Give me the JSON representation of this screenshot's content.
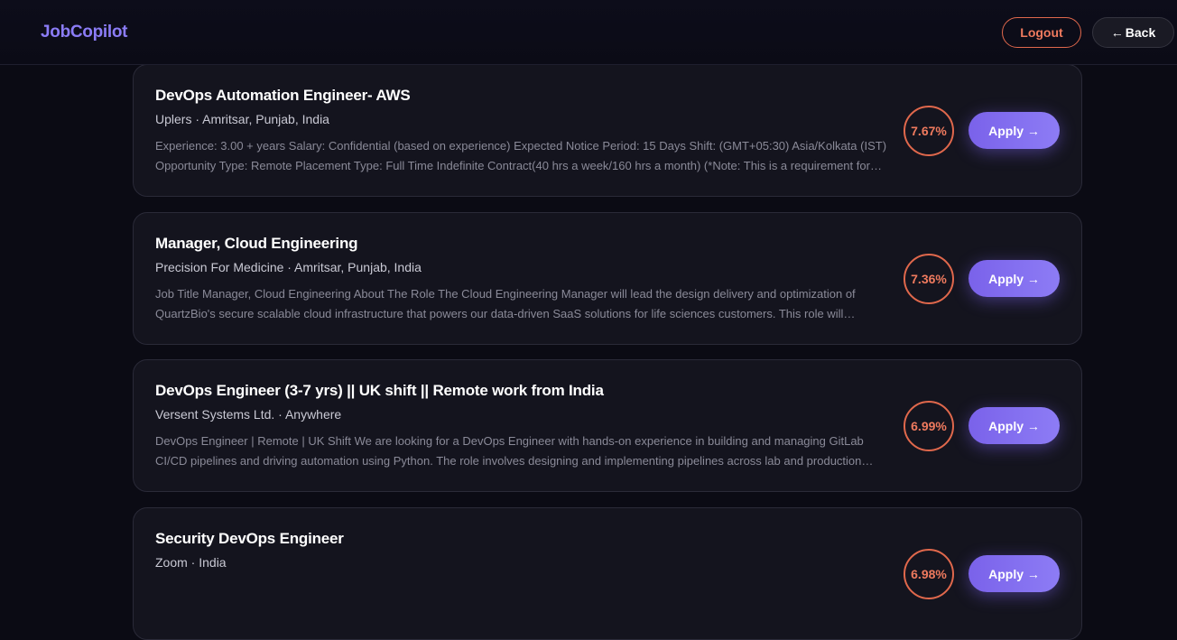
{
  "header": {
    "logo": "JobCopilot",
    "logout_label": "Logout",
    "back_label": "Back",
    "back_arrow": "←"
  },
  "colors": {
    "accent": "#8b7cf6",
    "score_ring": "#e0684c",
    "background": "#0b0b14",
    "card": "#14141e"
  },
  "icons": [
    "arrow-left-icon",
    "arrow-right-icon"
  ],
  "jobs": [
    {
      "title": "DevOps Automation Engineer- AWS",
      "meta": "Uplers · Amritsar, Punjab, India",
      "description": "Experience: 3.00 + years Salary: Confidential (based on experience) Expected Notice Period: 15 Days Shift: (GMT+05:30) Asia/Kolkata (IST) Opportunity Type: Remote Placement Type: Full Time Indefinite Contract(40 hrs a week/160 hrs a month) (*Note: This is a requirement for one of Uplers' client)",
      "score": "7.67%",
      "apply_label": "Apply →"
    },
    {
      "title": "Manager, Cloud Engineering",
      "meta": "Precision For Medicine · Amritsar, Punjab, India",
      "description": "Job Title Manager, Cloud Engineering About The Role The Cloud Engineering Manager will lead the design delivery and optimization of QuartzBio's secure scalable cloud infrastructure that powers our data-driven SaaS solutions for life sciences customers. This role will oversee",
      "score": "7.36%",
      "apply_label": "Apply →"
    },
    {
      "title": "DevOps Engineer (3-7 yrs) || UK shift || Remote work from India",
      "meta": "Versent Systems Ltd. · Anywhere",
      "description": "DevOps Engineer | Remote | UK Shift We are looking for a DevOps Engineer with hands-on experience in building and managing GitLab CI/CD pipelines and driving automation using Python. The role involves designing and implementing pipelines across lab and production environments",
      "score": "6.99%",
      "apply_label": "Apply →"
    },
    {
      "title": "Security DevOps Engineer",
      "meta": "Zoom · India",
      "description": "",
      "score": "6.98%",
      "apply_label": "Apply →"
    }
  ]
}
